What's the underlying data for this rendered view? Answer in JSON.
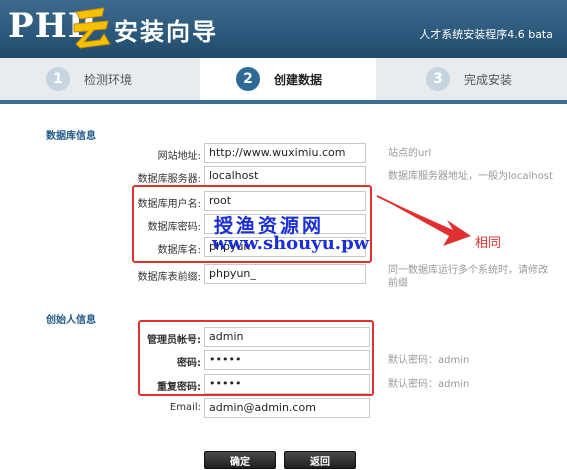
{
  "header": {
    "logo_php": "PHP",
    "logo_text": "安装向导",
    "version": "人才系统安装程序4.6 bata"
  },
  "steps": [
    {
      "num": "1",
      "label": "检测环境"
    },
    {
      "num": "2",
      "label": "创建数据"
    },
    {
      "num": "3",
      "label": "完成安装"
    }
  ],
  "db_section": {
    "title": "数据库信息",
    "fields": [
      {
        "label": "网站地址:",
        "value": "http://www.wuximiu.com",
        "hint": "站点的url"
      },
      {
        "label": "数据库服务器:",
        "value": "localhost",
        "hint": "数据库服务器地址，一般为localhost"
      },
      {
        "label": "数据库用户名:",
        "value": "root",
        "hint": ""
      },
      {
        "label": "数据库密码:",
        "value": "",
        "hint": ""
      },
      {
        "label": "数据库名:",
        "value": "phpyun",
        "hint": ""
      },
      {
        "label": "数据库表前缀:",
        "value": "phpyun_",
        "hint_line1": "同一数据库运行多个系统时，请修改",
        "hint_line2": "前缀"
      }
    ]
  },
  "admin_section": {
    "title": "创始人信息",
    "fields": [
      {
        "label": "管理员帐号:",
        "value": "admin",
        "hint": ""
      },
      {
        "label": "密码:",
        "value": "•••••",
        "hint": "默认密码：admin"
      },
      {
        "label": "重复密码:",
        "value": "•••••",
        "hint": "默认密码：admin"
      },
      {
        "label": "Email:",
        "value": "admin@admin.com",
        "hint": ""
      }
    ]
  },
  "annotation": {
    "watermark_line1": "授渔资源网",
    "watermark_line2": "www.shouyu.pw",
    "same_label": "相同",
    "accent_color": "#e03030"
  },
  "buttons": {
    "confirm": "确定",
    "back": "返回"
  }
}
